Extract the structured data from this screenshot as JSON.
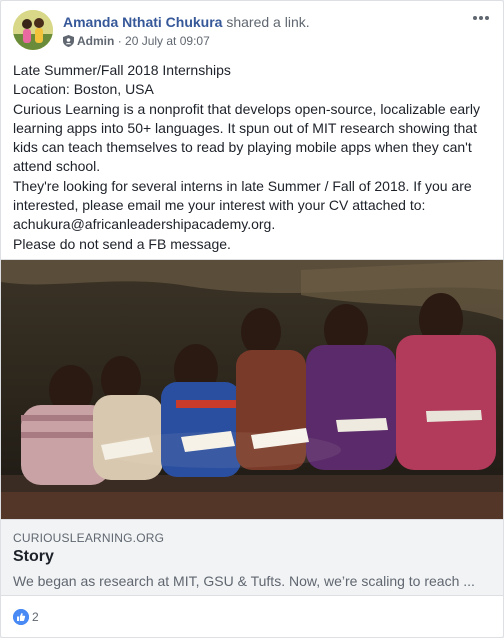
{
  "post": {
    "author": "Amanda Nthati Chukura",
    "action": "shared a link.",
    "role": "Admin",
    "timestamp": "20 July at 09:07",
    "separator": "·",
    "text": "Late Summer/Fall 2018 Internships\nLocation: Boston, USA\nCurious Learning is a nonprofit that develops open-source, localizable early learning apps into 50+ languages. It spun out of MIT research showing that kids can teach themselves to read by playing mobile apps when they can't attend school.\nThey're looking for several interns in late Summer / Fall of 2018. If you are interested, please email me your interest with your CV attached to: achukura@africanleadershipacademy.org.\nPlease do not send a FB message."
  },
  "link_preview": {
    "domain": "CURIOUSLEARNING.ORG",
    "title": "Story",
    "description": "We began as research at MIT, GSU & Tufts. Now, we’re scaling to reach ..."
  },
  "reactions": {
    "count": "2",
    "icon": "like-icon"
  },
  "colors": {
    "author_link": "#365899",
    "secondary_text": "#606770",
    "like_blue": "#4a8af4"
  }
}
